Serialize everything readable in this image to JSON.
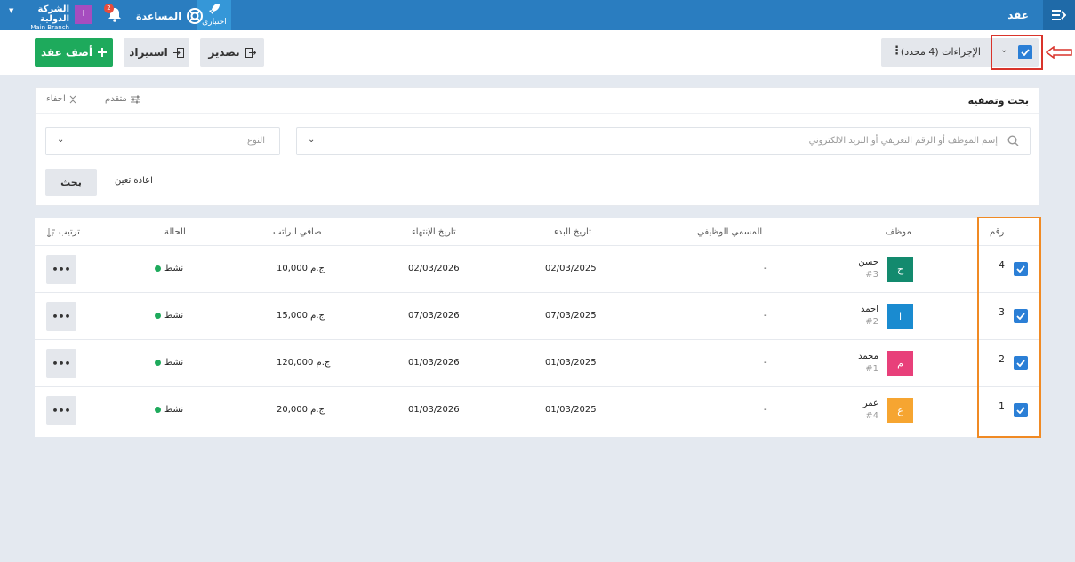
{
  "topbar": {
    "page_title": "عقد",
    "beta_label": "اختبارى",
    "help_label": "المساعدة",
    "notifications_count": "2",
    "user_initial": "ا",
    "company_name": "الشركة الدولية",
    "branch_name": "Main Branch"
  },
  "actions": {
    "add_label": "أضف عقد",
    "import_label": "استيراد",
    "export_label": "تصدير",
    "bulk_label": "الإجراءات (4 محدد)"
  },
  "filter": {
    "title": "بحث وتصفيه",
    "advanced_label": "متقدم",
    "hide_label": "اخفاء",
    "search_placeholder": "إسم الموظف أو الرقم التعريفي أو البريد الالكتروني",
    "type_placeholder": "النوع",
    "search_button": "بحث",
    "reset_button": "اعادة تعين"
  },
  "table": {
    "headers": {
      "number": "رقم",
      "employee": "موظف",
      "job_title": "المسمي الوظيفي",
      "start_date": "تاريخ البدء",
      "end_date": "تاريخ الإنتهاء",
      "net_salary": "صافي الراتب",
      "status": "الحالة",
      "sort": "ترتيب"
    },
    "rows": [
      {
        "num": "4",
        "name": "حسن",
        "code": "#3",
        "initial": "ح",
        "color": "#138a6e",
        "job": "-",
        "start": "02/03/2025",
        "end": "02/03/2026",
        "salary": "10,000 ج.م",
        "status": "نشط",
        "more": "•••"
      },
      {
        "num": "3",
        "name": "احمد",
        "code": "#2",
        "initial": "ا",
        "color": "#1a8bd0",
        "job": "-",
        "start": "07/03/2025",
        "end": "07/03/2026",
        "salary": "15,000 ج.م",
        "status": "نشط",
        "more": "•••"
      },
      {
        "num": "2",
        "name": "محمد",
        "code": "#1",
        "initial": "م",
        "color": "#e8407a",
        "job": "-",
        "start": "01/03/2025",
        "end": "01/03/2026",
        "salary": "120,000 ج.م",
        "status": "نشط",
        "more": "•••"
      },
      {
        "num": "1",
        "name": "عمر",
        "code": "#4",
        "initial": "ع",
        "color": "#f6a531",
        "job": "-",
        "start": "01/03/2025",
        "end": "01/03/2026",
        "salary": "20,000 ج.م",
        "status": "نشط",
        "more": "•••"
      }
    ]
  },
  "colors": {
    "topbar": "#2a7dc0",
    "primary_green": "#1eaa5c",
    "checkbox_blue": "#2b7fd6",
    "highlight_red": "#d9342b",
    "highlight_orange": "#f08a24"
  }
}
